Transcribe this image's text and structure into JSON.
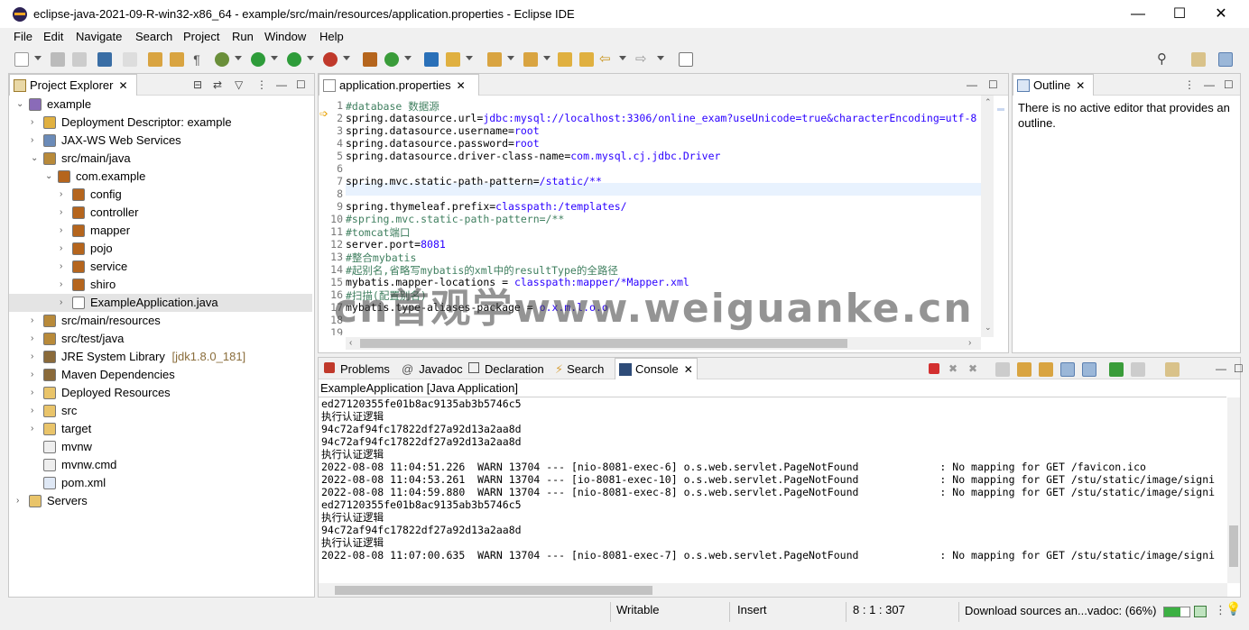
{
  "window": {
    "title": "eclipse-java-2021-09-R-win32-x86_64 - example/src/main/resources/application.properties - Eclipse IDE",
    "minimize": "—",
    "maximize": "☐",
    "close": "✕"
  },
  "menu": [
    "File",
    "Edit",
    "Navigate",
    "Search",
    "Project",
    "Run",
    "Window",
    "Help"
  ],
  "explorer": {
    "title": "Project Explorer",
    "items": [
      {
        "label": "example",
        "icon": "project-icon",
        "extra": ""
      },
      {
        "label": "Deployment Descriptor: example",
        "icon": "descriptor-icon",
        "extra": ""
      },
      {
        "label": "JAX-WS Web Services",
        "icon": "webservice-icon",
        "extra": ""
      },
      {
        "label": "src/main/java",
        "icon": "source-folder-icon",
        "extra": ""
      },
      {
        "label": "com.example",
        "icon": "package-icon",
        "extra": ""
      },
      {
        "label": "config",
        "icon": "package-icon",
        "extra": ""
      },
      {
        "label": "controller",
        "icon": "package-icon",
        "extra": ""
      },
      {
        "label": "mapper",
        "icon": "package-icon",
        "extra": ""
      },
      {
        "label": "pojo",
        "icon": "package-icon",
        "extra": ""
      },
      {
        "label": "service",
        "icon": "package-icon",
        "extra": ""
      },
      {
        "label": "shiro",
        "icon": "package-icon",
        "extra": ""
      },
      {
        "label": "ExampleApplication.java",
        "icon": "java-file-icon",
        "extra": ""
      },
      {
        "label": "src/main/resources",
        "icon": "source-folder-icon",
        "extra": ""
      },
      {
        "label": "src/test/java",
        "icon": "source-folder-icon",
        "extra": ""
      },
      {
        "label": "JRE System Library",
        "icon": "library-icon",
        "extra": "[jdk1.8.0_181]"
      },
      {
        "label": "Maven Dependencies",
        "icon": "library-icon",
        "extra": ""
      },
      {
        "label": "Deployed Resources",
        "icon": "folder-icon",
        "extra": ""
      },
      {
        "label": "src",
        "icon": "folder-icon",
        "extra": ""
      },
      {
        "label": "target",
        "icon": "folder-icon",
        "extra": ""
      },
      {
        "label": "mvnw",
        "icon": "file-icon",
        "extra": ""
      },
      {
        "label": "mvnw.cmd",
        "icon": "file-icon",
        "extra": ""
      },
      {
        "label": "pom.xml",
        "icon": "xml-file-icon",
        "extra": ""
      },
      {
        "label": "Servers",
        "icon": "folder-icon",
        "extra": ""
      }
    ]
  },
  "editor": {
    "tab": "application.properties",
    "lines": [
      {
        "n": "1",
        "k": "",
        "v": "",
        "c": "#database 数据源"
      },
      {
        "n": "2",
        "k": "spring.datasource.url=",
        "v": "jdbc:mysql://localhost:3306/online_exam?useUnicode=true&characterEncoding=utf-8",
        "c": ""
      },
      {
        "n": "3",
        "k": "spring.datasource.username=",
        "v": "root",
        "c": ""
      },
      {
        "n": "4",
        "k": "spring.datasource.password=",
        "v": "root",
        "c": ""
      },
      {
        "n": "5",
        "k": "spring.datasource.driver-class-name=",
        "v": "com.mysql.cj.jdbc.Driver",
        "c": ""
      },
      {
        "n": "6",
        "k": "",
        "v": "",
        "c": ""
      },
      {
        "n": "7",
        "k": "spring.mvc.static-path-pattern=",
        "v": "/static/**",
        "c": ""
      },
      {
        "n": "8",
        "k": "",
        "v": "",
        "c": ""
      },
      {
        "n": "9",
        "k": "spring.thymeleaf.prefix=",
        "v": "classpath:/templates/",
        "c": ""
      },
      {
        "n": "10",
        "k": "",
        "v": "",
        "c": "#spring.mvc.static-path-pattern=/**"
      },
      {
        "n": "11",
        "k": "",
        "v": "",
        "c": "#tomcat端口"
      },
      {
        "n": "12",
        "k": "server.port=",
        "v": "8081",
        "c": ""
      },
      {
        "n": "13",
        "k": "",
        "v": "",
        "c": "#整合mybatis"
      },
      {
        "n": "14",
        "k": "",
        "v": "",
        "c": "#起别名,省略写mybatis的xml中的resultType的全路径"
      },
      {
        "n": "15",
        "k": "mybatis.mapper-locations = ",
        "v": "classpath:mapper/*Mapper.xml",
        "c": ""
      },
      {
        "n": "16",
        "k": "",
        "v": "",
        "c": "#扫描(配置别名)"
      },
      {
        "n": "17",
        "k": "mybatis.type-aliases-package = ",
        "v": "o.x.m.l.o.o",
        "c": ""
      },
      {
        "n": "18",
        "k": "",
        "v": "",
        "c": ""
      },
      {
        "n": "19",
        "k": "",
        "v": "",
        "c": ""
      }
    ]
  },
  "outline": {
    "title": "Outline",
    "message": "There is no active editor that provides an outline."
  },
  "bottom": {
    "tabs": [
      "Problems",
      "Javadoc",
      "Declaration",
      "Search",
      "Console"
    ],
    "console_header": "ExampleApplication [Java Application]",
    "lines": [
      "ed27120355fe01b8ac9135ab3b5746c5",
      "执行认证逻辑",
      "94c72af94fc17822df27a92d13a2aa8d",
      "94c72af94fc17822df27a92d13a2aa8d",
      "执行认证逻辑",
      "2022-08-08 11:04:51.226  WARN 13704 --- [nio-8081-exec-6] o.s.web.servlet.PageNotFound             : No mapping for GET /favicon.ico",
      "2022-08-08 11:04:53.261  WARN 13704 --- [io-8081-exec-10] o.s.web.servlet.PageNotFound             : No mapping for GET /stu/static/image/signi",
      "2022-08-08 11:04:59.880  WARN 13704 --- [nio-8081-exec-8] o.s.web.servlet.PageNotFound             : No mapping for GET /stu/static/image/signi",
      "ed27120355fe01b8ac9135ab3b5746c5",
      "执行认证逻辑",
      "94c72af94fc17822df27a92d13a2aa8d",
      "执行认证逻辑",
      "2022-08-08 11:07:00.635  WARN 13704 --- [nio-8081-exec-7] o.s.web.servlet.PageNotFound             : No mapping for GET /stu/static/image/signi"
    ]
  },
  "status": {
    "writable": "Writable",
    "insert": "Insert",
    "position": "8 : 1 : 307",
    "task": "Download sources an...vadoc: (66%)",
    "progress": 0.66
  },
  "watermark": "cn首观学www.weiguanke.cn",
  "colors": {
    "accent": "#1e6bd6",
    "error": "#d32f2f",
    "comment": "#3f7f5f",
    "value": "#2a00ff"
  }
}
